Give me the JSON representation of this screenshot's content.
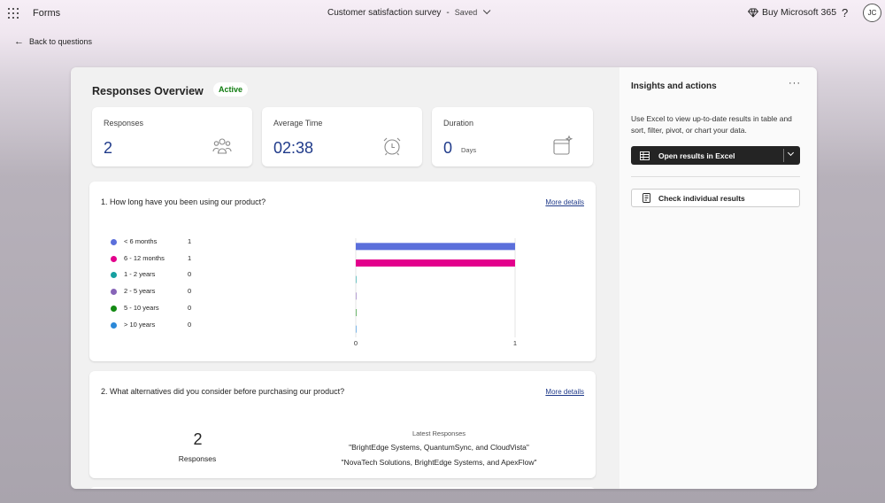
{
  "topbar": {
    "app_name": "Forms",
    "doc_title": "Customer satisfaction survey",
    "separator": "-",
    "status": "Saved",
    "buy_label": "Buy Microsoft 365",
    "help_label": "?",
    "avatar_initials": "JC"
  },
  "nav": {
    "back_label": "Back to questions"
  },
  "overview": {
    "title": "Responses Overview",
    "badge": "Active",
    "stats": {
      "responses": {
        "label": "Responses",
        "value": "2",
        "icon": "people-icon"
      },
      "avg_time": {
        "label": "Average Time",
        "value": "02:38",
        "icon": "alarm-clock-icon"
      },
      "duration": {
        "label": "Duration",
        "value": "0",
        "unit": "Days",
        "icon": "calendar-sparkle-icon"
      }
    }
  },
  "q1": {
    "title": "1. How long have you been using our product?",
    "more_details": "More details"
  },
  "chart_data": {
    "type": "bar",
    "orientation": "horizontal",
    "categories": [
      "< 6 months",
      "6 - 12 months",
      "1 - 2 years",
      "2 - 5 years",
      "5 - 10 years",
      "> 10 years"
    ],
    "values": [
      1,
      1,
      0,
      0,
      0,
      0
    ],
    "colors": [
      "#5b6fdb",
      "#e3008c",
      "#16a0a0",
      "#8764b8",
      "#138a13",
      "#2b88d8"
    ],
    "xlim": [
      0,
      1
    ],
    "x_ticks": [
      "0",
      "1"
    ],
    "legend": "left"
  },
  "q2": {
    "title": "2. What alternatives did you consider before purchasing our product?",
    "more_details": "More details",
    "count": "2",
    "count_label": "Responses",
    "latest_heading": "Latest Responses",
    "latest": [
      "\"BrightEdge Systems, QuantumSync, and CloudVista\"",
      "\"NovaTech Solutions, BrightEdge Systems, and ApexFlow\""
    ]
  },
  "insights": {
    "title": "Insights and actions",
    "more_icon": "more-icon",
    "description": "Use Excel to view up-to-date results in table and sort, filter, pivot, or chart your data.",
    "excel_button": "Open results in Excel",
    "check_button": "Check individual results"
  }
}
